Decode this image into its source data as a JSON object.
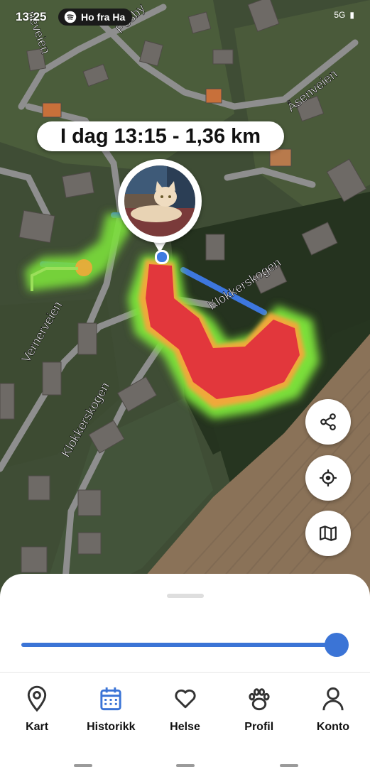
{
  "status_bar": {
    "time": "13:25",
    "spotify_text": "Ho fra Ha",
    "right_text": "5G"
  },
  "map": {
    "street_labels": [
      "neveien",
      "Posby",
      "Åsenveien",
      "Klokkerskogen",
      "Vernerveien",
      "Klokkerskogen"
    ],
    "date_pill": "I dag 13:15 - 1,36 km"
  },
  "map_buttons": {
    "share": "share-icon",
    "locate": "locate-icon",
    "layers": "map-icon"
  },
  "timeline": {
    "progress": 1.0
  },
  "colors": {
    "accent": "#3b74d6",
    "heat_high": "#e0303c",
    "heat_low": "#6bd12f"
  },
  "nav": {
    "items": [
      {
        "label": "Kart",
        "icon": "map-pin-icon",
        "active": false
      },
      {
        "label": "Historikk",
        "icon": "calendar-icon",
        "active": true
      },
      {
        "label": "Helse",
        "icon": "heart-icon",
        "active": false
      },
      {
        "label": "Profil",
        "icon": "paw-icon",
        "active": false
      },
      {
        "label": "Konto",
        "icon": "person-icon",
        "active": false
      }
    ]
  }
}
